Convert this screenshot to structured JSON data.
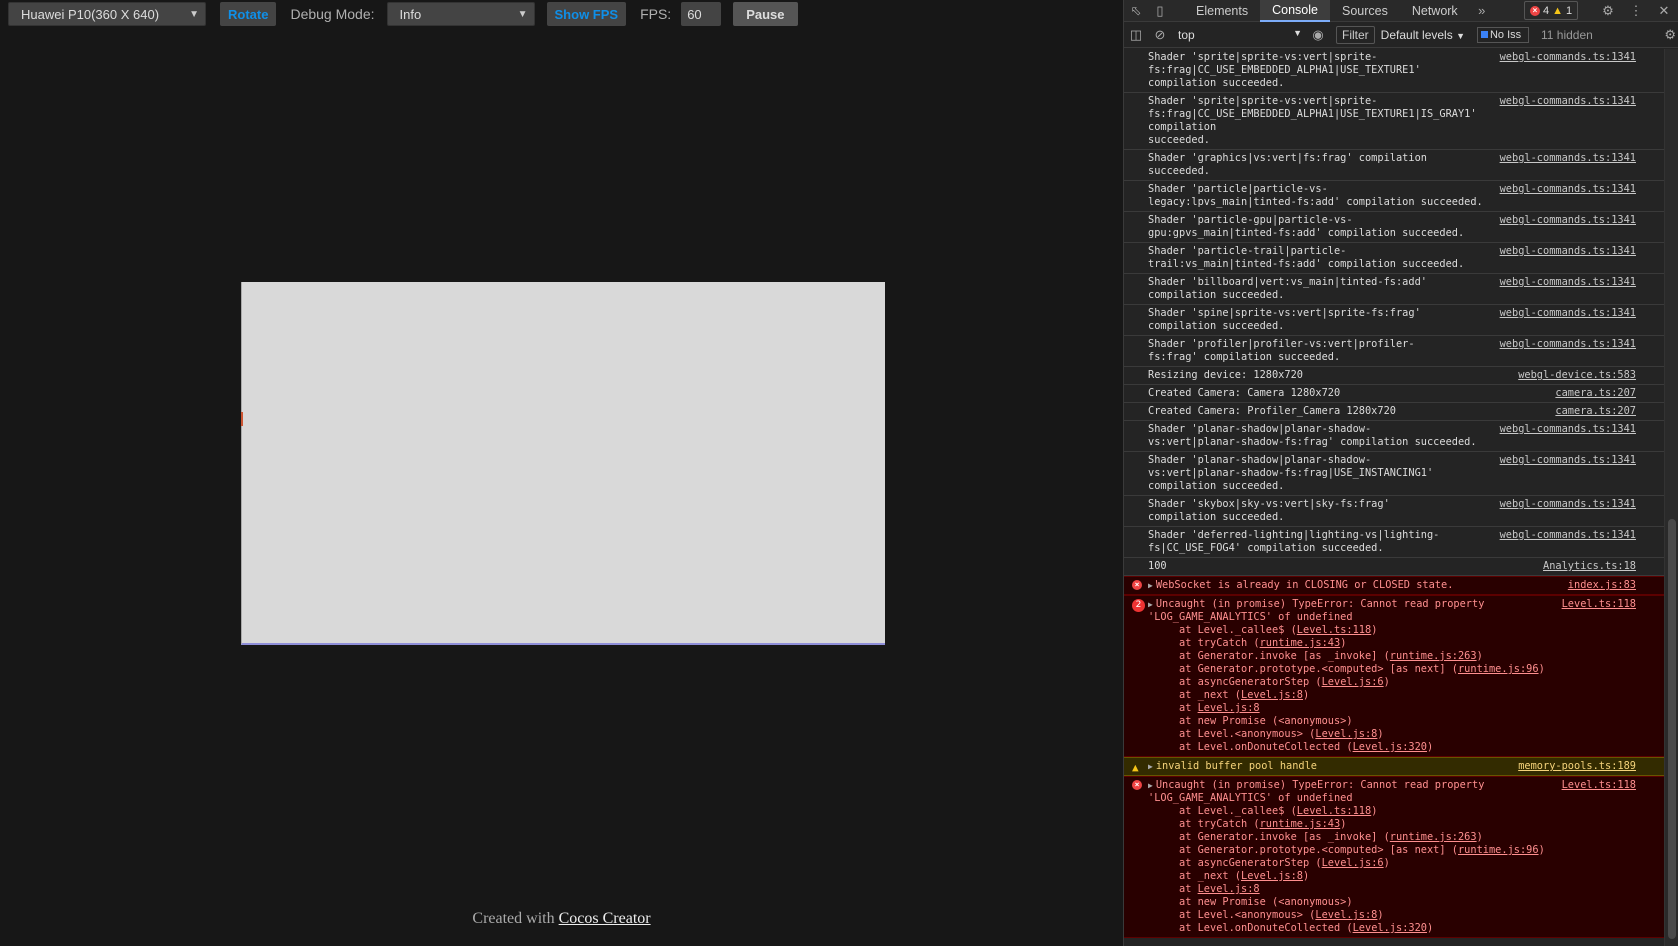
{
  "preview": {
    "device_select": "Huawei P10(360 X 640)",
    "rotate_label": "Rotate",
    "debug_mode_label": "Debug Mode:",
    "debug_mode_select": "Info",
    "show_fps_label": "Show FPS",
    "fps_label": "FPS:",
    "fps_value": "60",
    "pause_label": "Pause",
    "footer_prefix": "Created with",
    "footer_link": "Cocos Creator"
  },
  "devtools": {
    "tabs": [
      "Elements",
      "Console",
      "Sources",
      "Network"
    ],
    "active_tab": "Console",
    "more_tabs": "»",
    "error_count": "4",
    "warning_count": "1",
    "context": "top",
    "filter_label": "Filter",
    "levels_label": "Default levels",
    "issues_label": "No Iss",
    "hidden_count": "11 hidden"
  },
  "logs": [
    {
      "text": "Shader 'sprite|sprite-vs:vert|sprite-\nfs:frag|CC_USE_EMBEDDED_ALPHA1|USE_TEXTURE1' compilation succeeded.",
      "src": "webgl-commands.ts:1341"
    },
    {
      "text": "Shader 'sprite|sprite-vs:vert|sprite-\nfs:frag|CC_USE_EMBEDDED_ALPHA1|USE_TEXTURE1|IS_GRAY1' compilation\nsucceeded.",
      "src": "webgl-commands.ts:1341"
    },
    {
      "text": "Shader 'graphics|vs:vert|fs:frag' compilation\nsucceeded.",
      "src": "webgl-commands.ts:1341"
    },
    {
      "text": "Shader 'particle|particle-vs-\nlegacy:lpvs_main|tinted-fs:add' compilation succeeded.",
      "src": "webgl-commands.ts:1341"
    },
    {
      "text": "Shader 'particle-gpu|particle-vs-\ngpu:gpvs_main|tinted-fs:add' compilation succeeded.",
      "src": "webgl-commands.ts:1341"
    },
    {
      "text": "Shader 'particle-trail|particle-\ntrail:vs_main|tinted-fs:add' compilation succeeded.",
      "src": "webgl-commands.ts:1341"
    },
    {
      "text": "Shader 'billboard|vert:vs_main|tinted-fs:add'\ncompilation succeeded.",
      "src": "webgl-commands.ts:1341"
    },
    {
      "text": "Shader 'spine|sprite-vs:vert|sprite-fs:frag'\ncompilation succeeded.",
      "src": "webgl-commands.ts:1341"
    },
    {
      "text": "Shader 'profiler|profiler-vs:vert|profiler-\nfs:frag' compilation succeeded.",
      "src": "webgl-commands.ts:1341"
    },
    {
      "text": "Resizing device: 1280x720",
      "src": "webgl-device.ts:583"
    },
    {
      "text": "Created Camera: Camera 1280x720",
      "src": "camera.ts:207"
    },
    {
      "text": "Created Camera: Profiler_Camera 1280x720",
      "src": "camera.ts:207"
    },
    {
      "text": "Shader 'planar-shadow|planar-shadow-\nvs:vert|planar-shadow-fs:frag' compilation succeeded.",
      "src": "webgl-commands.ts:1341"
    },
    {
      "text": "Shader 'planar-shadow|planar-shadow-\nvs:vert|planar-shadow-fs:frag|USE_INSTANCING1' compilation succeeded.",
      "src": "webgl-commands.ts:1341"
    },
    {
      "text": "Shader 'skybox|sky-vs:vert|sky-fs:frag'\ncompilation succeeded.",
      "src": "webgl-commands.ts:1341"
    },
    {
      "text": "Shader 'deferred-lighting|lighting-vs|lighting-\nfs|CC_USE_FOG4' compilation succeeded.",
      "src": "webgl-commands.ts:1341"
    },
    {
      "text": "100",
      "src": "Analytics.ts:18"
    }
  ],
  "websocket_error": {
    "text": "WebSocket is already in CLOSING or CLOSED state.",
    "src": "index.js:83"
  },
  "promise_error_1": {
    "count": "2",
    "text": "Uncaught (in promise) TypeError: Cannot read property\n'LOG_GAME_ANALYTICS' of undefined",
    "src": "Level.ts:118"
  },
  "warning": {
    "text": "invalid buffer pool handle",
    "src": "memory-pools.ts:189"
  },
  "promise_error_2": {
    "text": "Uncaught (in promise) TypeError: Cannot read property\n'LOG_GAME_ANALYTICS' of undefined",
    "src": "Level.ts:118"
  },
  "stack": [
    {
      "pre": "at Level._callee$ (",
      "link": "Level.ts:118",
      "post": ")"
    },
    {
      "pre": "at tryCatch (",
      "link": "runtime.js:43",
      "post": ")"
    },
    {
      "pre": "at Generator.invoke [as _invoke] (",
      "link": "runtime.js:263",
      "post": ")"
    },
    {
      "pre": "at Generator.prototype.<computed> [as next] (",
      "link": "runtime.js:96",
      "post": ")"
    },
    {
      "pre": "at asyncGeneratorStep (",
      "link": "Level.js:6",
      "post": ")"
    },
    {
      "pre": "at _next (",
      "link": "Level.js:8",
      "post": ")"
    },
    {
      "pre": "at ",
      "link": "Level.js:8",
      "post": ""
    },
    {
      "pre": "at new Promise (<anonymous>)",
      "link": "",
      "post": ""
    },
    {
      "pre": "at Level.<anonymous> (",
      "link": "Level.js:8",
      "post": ")"
    },
    {
      "pre": "at Level.onDonuteCollected (",
      "link": "Level.js:320",
      "post": ")"
    }
  ],
  "prompt_symbol": "›"
}
